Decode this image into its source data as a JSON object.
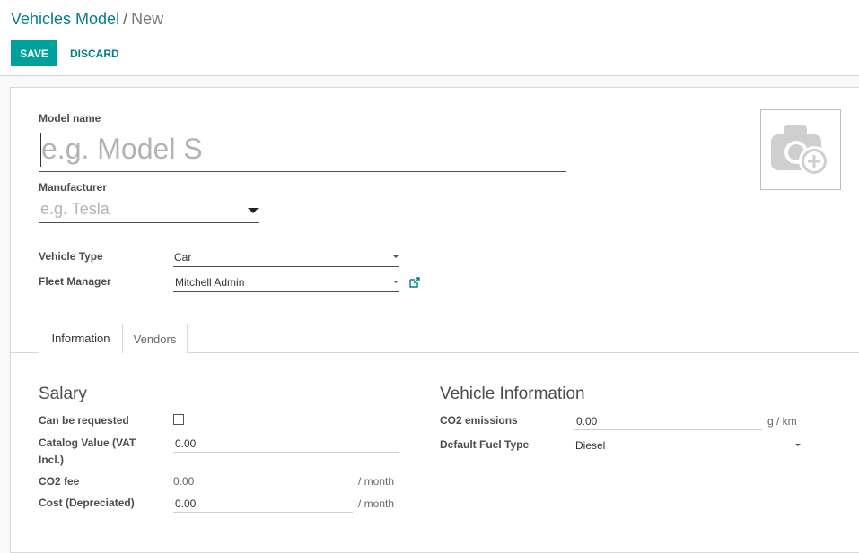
{
  "breadcrumb": {
    "parent": "Vehicles Model",
    "separator": "/",
    "current": "New"
  },
  "toolbar": {
    "save_label": "SAVE",
    "discard_label": "DISCARD"
  },
  "form": {
    "model_name": {
      "label": "Model name",
      "placeholder": "e.g. Model S",
      "value": ""
    },
    "manufacturer": {
      "label": "Manufacturer",
      "placeholder": "e.g. Tesla",
      "value": ""
    },
    "vehicle_type": {
      "label": "Vehicle Type",
      "value": "Car"
    },
    "fleet_manager": {
      "label": "Fleet Manager",
      "value": "Mitchell Admin"
    },
    "image": {
      "icon": "camera-plus-icon"
    }
  },
  "tabs": [
    {
      "label": "Information",
      "active": true
    },
    {
      "label": "Vendors",
      "active": false
    }
  ],
  "salary": {
    "title": "Salary",
    "can_be_requested": {
      "label": "Can be requested",
      "checked": false
    },
    "catalog_value": {
      "label_line1": "Catalog Value (VAT",
      "label_line2": "Incl.)",
      "value": "0.00"
    },
    "co2_fee": {
      "label": "CO2 fee",
      "value": "0.00",
      "unit": "/ month"
    },
    "cost_depreciated": {
      "label": "Cost (Depreciated)",
      "value": "0.00",
      "unit": "/ month"
    }
  },
  "vehicle_info": {
    "title": "Vehicle Information",
    "co2_emissions": {
      "label": "CO2 emissions",
      "value": "0.00",
      "unit": "g / km"
    },
    "default_fuel_type": {
      "label": "Default Fuel Type",
      "value": "Diesel"
    }
  },
  "colors": {
    "primary": "#00a09d",
    "link": "#017e84",
    "text": "#4c4c4c",
    "placeholder": "#b3b3b3"
  }
}
